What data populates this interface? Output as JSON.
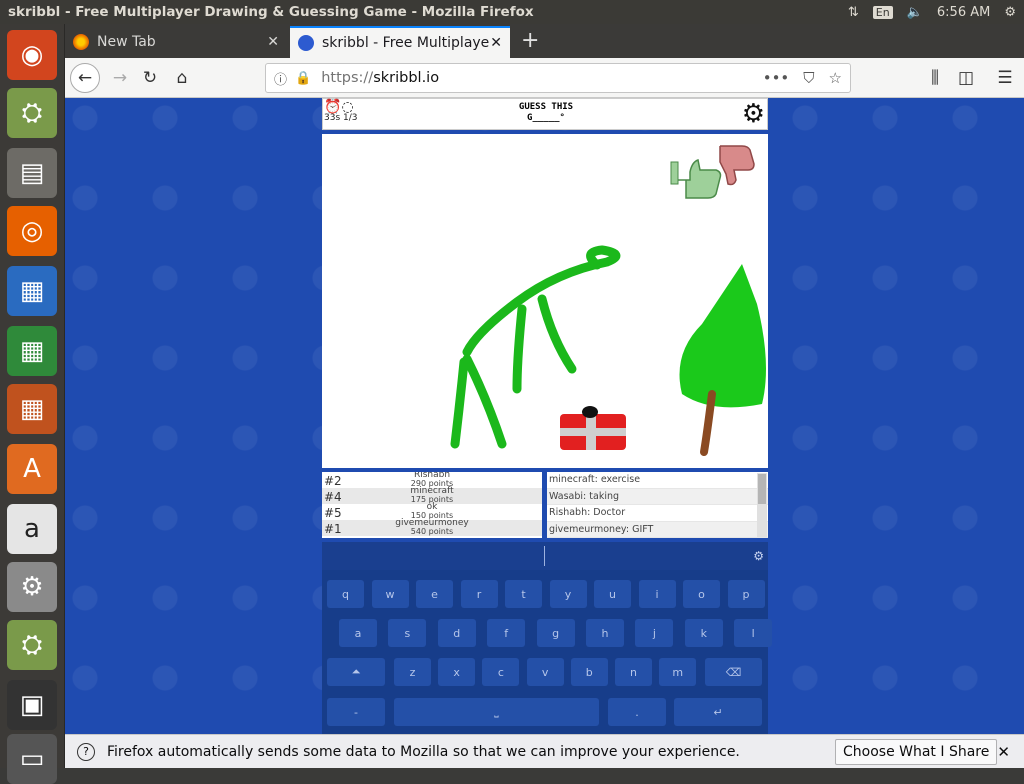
{
  "os": {
    "window_title": "skribbl - Free Multiplayer Drawing & Guessing Game - Mozilla Firefox",
    "lang": "En",
    "clock": "6:56 AM",
    "launcher": [
      {
        "name": "ubuntu-dash-icon",
        "glyph": "◉",
        "bg": "#d2451e"
      },
      {
        "name": "disk-installer-icon",
        "glyph": "⛭",
        "bg": "#7a9a4a"
      },
      {
        "name": "files-icon",
        "glyph": "▤",
        "bg": "#6d6b66"
      },
      {
        "name": "firefox-icon",
        "glyph": "◎",
        "bg": "#e66000"
      },
      {
        "name": "writer-icon",
        "glyph": "▦",
        "bg": "#2a6bc0"
      },
      {
        "name": "calc-icon",
        "glyph": "▦",
        "bg": "#2f8a3a"
      },
      {
        "name": "impress-icon",
        "glyph": "▦",
        "bg": "#c0521e"
      },
      {
        "name": "software-center-icon",
        "glyph": "A",
        "bg": "#e06a20"
      },
      {
        "name": "amazon-icon",
        "glyph": "a",
        "bg": "#e5e5e5"
      },
      {
        "name": "system-settings-icon",
        "glyph": "⚙",
        "bg": "#8a8a8a"
      },
      {
        "name": "disk-installer-2-icon",
        "glyph": "⛭",
        "bg": "#7a9a4a"
      },
      {
        "name": "save-disk-icon",
        "glyph": "▣",
        "bg": "#333"
      },
      {
        "name": "trash-icon",
        "glyph": "▭",
        "bg": "#555"
      }
    ]
  },
  "browser": {
    "tabs": [
      {
        "label": "New Tab"
      },
      {
        "label": "skribbl - Free Multiplaye"
      }
    ],
    "url_prefix": "https://",
    "url_host": "skribbl.io"
  },
  "game": {
    "timer": "33s",
    "round": "1/3",
    "guess_label": "GUESS THIS",
    "hint": "G_____°",
    "players": [
      {
        "rank": "#2",
        "name": "Rishabh",
        "points": "290 points"
      },
      {
        "rank": "#4",
        "name": "minecraft",
        "points": "175 points"
      },
      {
        "rank": "#5",
        "name": "ok",
        "points": "150 points"
      },
      {
        "rank": "#1",
        "name": "givemeurmoney",
        "points": "540 points"
      }
    ],
    "chat": [
      "minecraft: exercise",
      "Wasabi: taking",
      "Rishabh: Doctor",
      "givemeurmoney: GIFT"
    ]
  },
  "keyboard": {
    "row1": [
      "q",
      "w",
      "e",
      "r",
      "t",
      "y",
      "u",
      "i",
      "o",
      "p"
    ],
    "row2": [
      "a",
      "s",
      "d",
      "f",
      "g",
      "h",
      "j",
      "k",
      "l"
    ],
    "row3": [
      "z",
      "x",
      "c",
      "v",
      "b",
      "n",
      "m"
    ],
    "row4": [
      "-",
      "⎵",
      ".",
      "↵"
    ]
  },
  "notification": {
    "message": "Firefox automatically sends some data to Mozilla so that we can improve your experience.",
    "button": "Choose What I Share"
  }
}
